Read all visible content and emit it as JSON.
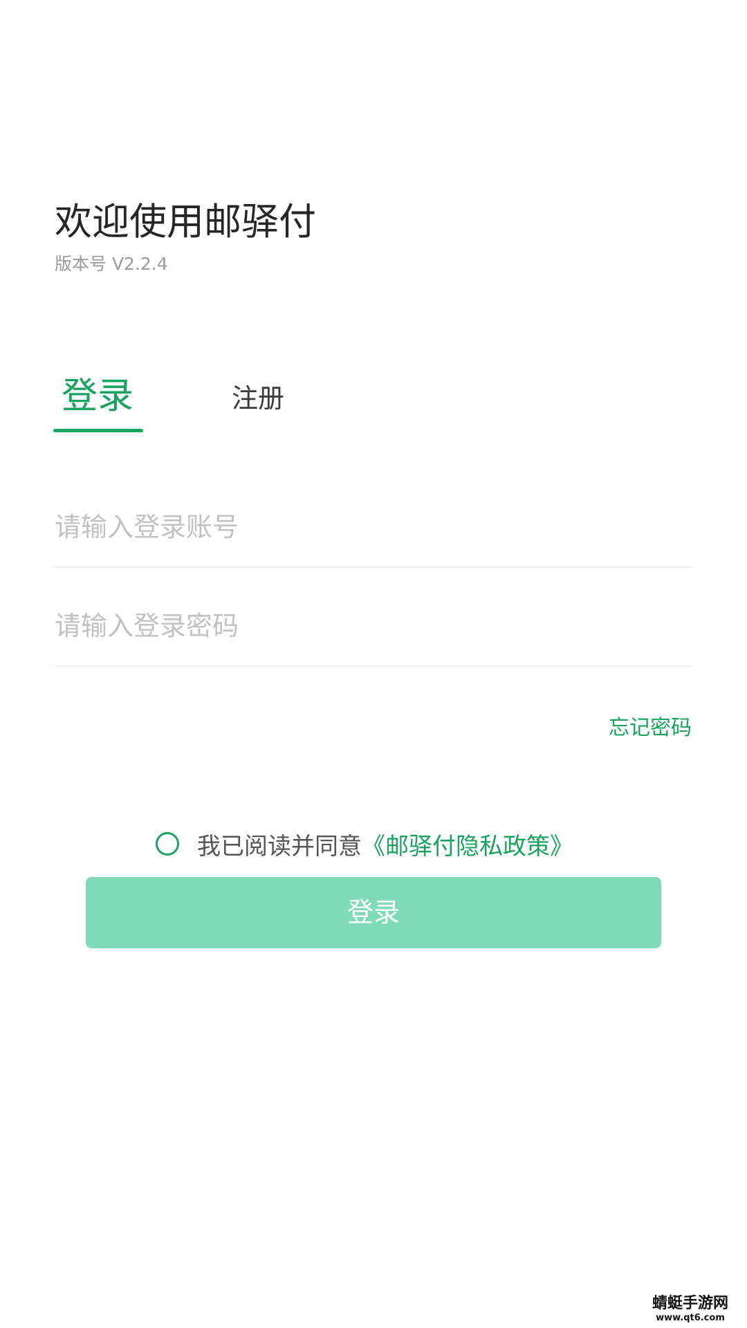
{
  "header": {
    "title": "欢迎使用邮驿付",
    "version": "版本号 V2.2.4"
  },
  "tabs": [
    {
      "label": "登录",
      "active": true
    },
    {
      "label": "注册",
      "active": false
    }
  ],
  "form": {
    "account": {
      "value": "",
      "placeholder": "请输入登录账号"
    },
    "password": {
      "value": "",
      "placeholder": "请输入登录密码"
    },
    "forgot_label": "忘记密码"
  },
  "agreement": {
    "checked": false,
    "text": "我已阅读并同意",
    "link_text": "《邮驿付隐私政策》"
  },
  "login_button_label": "登录",
  "watermark": {
    "name": "蜻蜓手游网",
    "url": "www.qt6.com"
  },
  "colors": {
    "accent": "#1aa260",
    "button_bg": "#80dbb8",
    "placeholder": "#c2c2c2"
  }
}
